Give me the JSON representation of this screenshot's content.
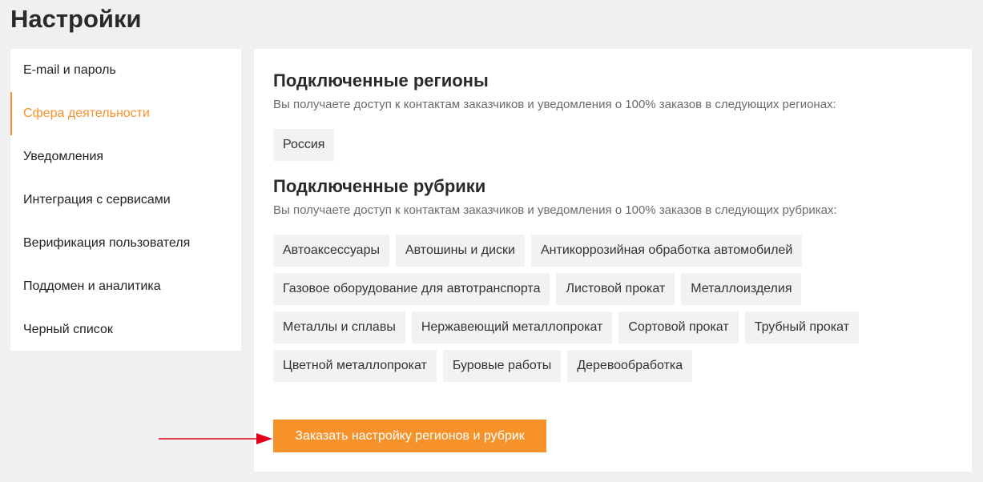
{
  "page": {
    "title": "Настройки"
  },
  "sidebar": {
    "items": [
      {
        "label": "E-mail и пароль"
      },
      {
        "label": "Сфера деятельности",
        "active": true
      },
      {
        "label": "Уведомления"
      },
      {
        "label": "Интеграция с сервисами"
      },
      {
        "label": "Верификация пользователя"
      },
      {
        "label": "Поддомен и аналитика"
      },
      {
        "label": "Черный список"
      }
    ]
  },
  "regions": {
    "title": "Подключенные регионы",
    "description": "Вы получаете доступ к контактам заказчиков и уведомления о 100% заказов в следующих регионах:",
    "items": [
      "Россия"
    ]
  },
  "categories": {
    "title": "Подключенные рубрики",
    "description": "Вы получаете доступ к контактам заказчиков и уведомления о 100% заказов в следующих рубриках:",
    "items": [
      "Автоаксессуары",
      "Автошины и диски",
      "Антикоррозийная обработка автомобилей",
      "Газовое оборудование для автотранспорта",
      "Листовой прокат",
      "Металлоизделия",
      "Металлы и сплавы",
      "Нержавеющий металлопрокат",
      "Сортовой прокат",
      "Трубный прокат",
      "Цветной металлопрокат",
      "Буровые работы",
      "Деревообработка"
    ]
  },
  "actions": {
    "order_label": "Заказать настройку регионов и рубрик"
  },
  "colors": {
    "accent": "#f7922b",
    "annotation_arrow": "#e3001b"
  },
  "annotation": {
    "icon": "arrow-right-icon"
  }
}
